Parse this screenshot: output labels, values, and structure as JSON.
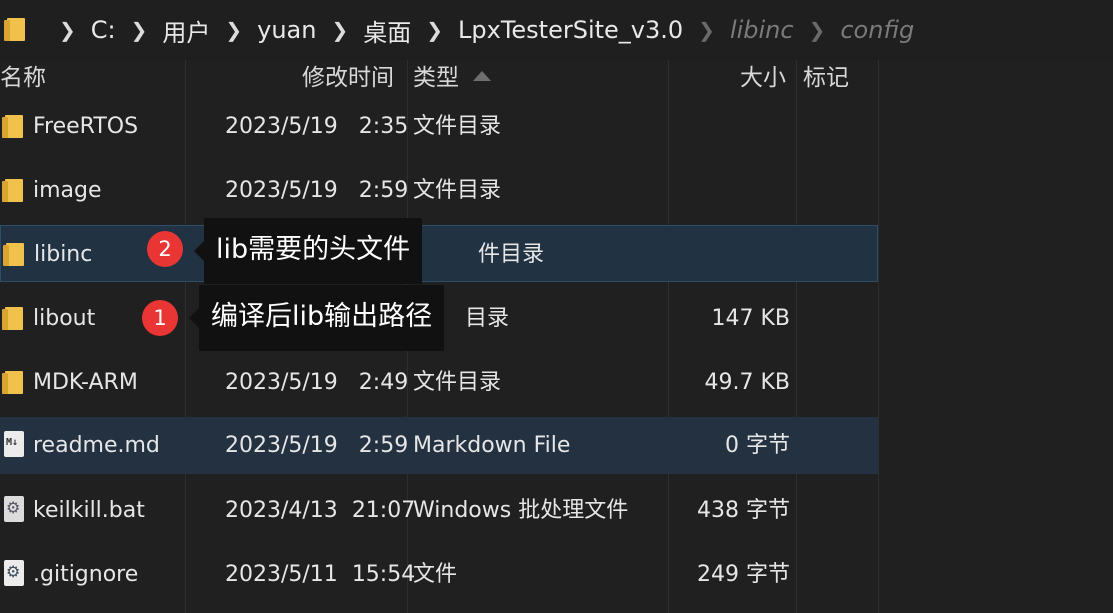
{
  "breadcrumb": {
    "icon": "folder-icon",
    "items": [
      "C:",
      "用户",
      "yuan",
      "桌面",
      "LpxTesterSite_v3.0",
      "libinc",
      "config"
    ]
  },
  "columns": {
    "name": "名称",
    "modified": "修改时间",
    "type": "类型",
    "size": "大小",
    "tag": "标记"
  },
  "rows": [
    {
      "icon": "folder-icon",
      "name": "FreeRTOS",
      "date": "2023/5/19",
      "time": "2:35",
      "type": "文件目录",
      "size": ""
    },
    {
      "icon": "folder-icon",
      "name": "image",
      "date": "2023/5/19",
      "time": "2:59",
      "type": "文件目录",
      "size": ""
    },
    {
      "icon": "folder-icon",
      "name": "libinc",
      "date": "",
      "time": "",
      "type": "件目录",
      "size": "",
      "selected": true
    },
    {
      "icon": "folder-icon",
      "name": "libout",
      "date": "",
      "time": "",
      "type": "目录",
      "size": "147 KB"
    },
    {
      "icon": "folder-icon",
      "name": "MDK-ARM",
      "date": "2023/5/19",
      "time": "2:49",
      "type": "文件目录",
      "size": "49.7 KB"
    },
    {
      "icon": "markdown-file-icon",
      "name": "readme.md",
      "date": "2023/5/19",
      "time": "2:59",
      "type": "Markdown File",
      "size": "0 字节",
      "hover": true
    },
    {
      "icon": "batch-file-icon",
      "name": "keilkill.bat",
      "date": "2023/4/13",
      "time": "21:07",
      "type": "Windows 批处理文件",
      "size": "438 字节"
    },
    {
      "icon": "settings-file-icon",
      "name": ".gitignore",
      "date": "2023/5/11",
      "time": "15:54",
      "type": "文件",
      "size": "249 字节"
    }
  ],
  "annotations": [
    {
      "number": "2",
      "text": "lib需要的头文件"
    },
    {
      "number": "1",
      "text": "编译后lib输出路径"
    }
  ],
  "colors": {
    "background": "#202020",
    "selected_row": "#213243",
    "folder": "#f0c14b",
    "badge": "#ea3535",
    "tooltip": "#111111"
  }
}
